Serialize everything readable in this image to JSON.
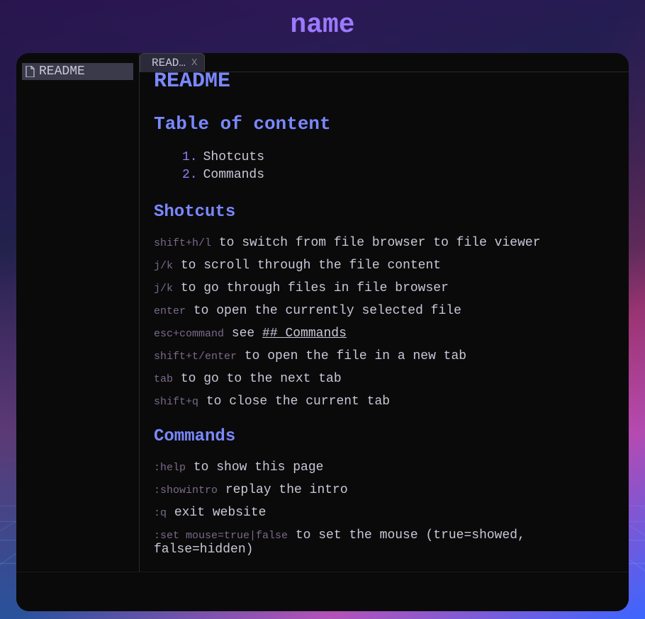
{
  "header": {
    "title": "name"
  },
  "sidebar": {
    "files": [
      {
        "icon": "file-icon",
        "name": "README"
      }
    ]
  },
  "tabs": [
    {
      "label": "READ…",
      "close": "X"
    }
  ],
  "doc": {
    "title": "README",
    "toc_heading": "Table of content",
    "toc": [
      {
        "num": "1.",
        "label": "Shotcuts"
      },
      {
        "num": "2.",
        "label": "Commands"
      }
    ],
    "shortcuts_heading": "Shotcuts",
    "shortcuts": [
      {
        "kbd": "shift+h/l",
        "text": " to switch from file browser to file viewer"
      },
      {
        "kbd": "j/k",
        "text": " to scroll through the file content"
      },
      {
        "kbd": "j/k",
        "text": " to go through files in file browser"
      },
      {
        "kbd": "enter",
        "text": " to open the currently selected file"
      },
      {
        "kbd": "esc+command",
        "text": " see ",
        "link": "## Commands"
      },
      {
        "kbd": "shift+t/enter",
        "text": " to open the file in a new tab"
      },
      {
        "kbd": "tab",
        "text": " to go to the next tab"
      },
      {
        "kbd": "shift+q",
        "text": " to close the current tab"
      }
    ],
    "commands_heading": "Commands",
    "commands": [
      {
        "kbd": ":help",
        "text": " to show this page"
      },
      {
        "kbd": ":showintro",
        "text": " replay the intro"
      },
      {
        "kbd": ":q",
        "text": " exit website"
      },
      {
        "kbd": ":set mouse=true|false",
        "text": " to set the mouse (true=showed, false=hidden)"
      }
    ]
  }
}
